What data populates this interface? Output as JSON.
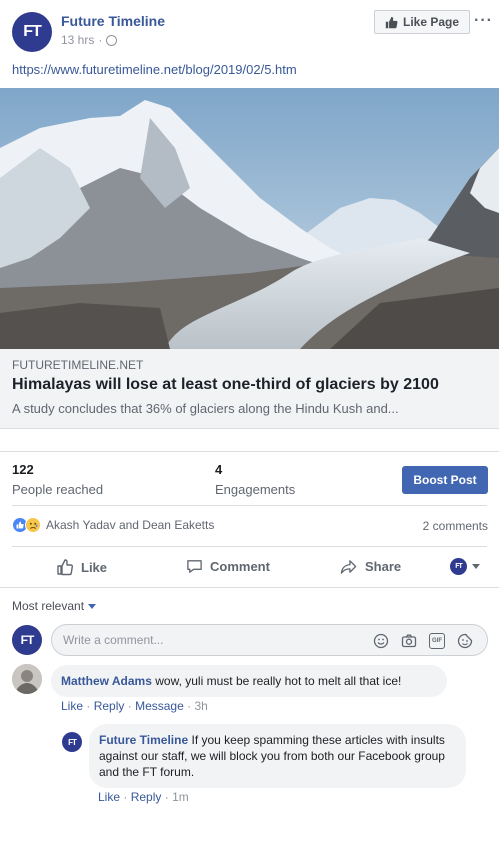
{
  "post": {
    "page_name": "Future Timeline",
    "logo_text": "FT",
    "time": "13 hrs",
    "separator": "·",
    "like_page_label": "Like Page",
    "more_label": "···",
    "link_url": "https://www.futuretimeline.net/blog/2019/02/5.htm"
  },
  "link_preview": {
    "domain": "FUTURETIMELINE.NET",
    "headline": "Himalayas will lose at least one-third of glaciers by 2100",
    "description": "A study concludes that 36% of glaciers along the Hindu Kush and..."
  },
  "stats": {
    "reached_value": "122",
    "reached_label": "People reached",
    "engagements_value": "4",
    "engagements_label": "Engagements",
    "boost_label": "Boost Post"
  },
  "reactions": {
    "names": "Akash Yadav and Dean Eaketts",
    "comments_count": "2 comments"
  },
  "actions": {
    "like": "Like",
    "comment": "Comment",
    "share": "Share"
  },
  "comments_section": {
    "sort_label": "Most relevant",
    "input_placeholder": "Write a comment...",
    "gif_label": "GIF"
  },
  "comments": [
    {
      "author": "Matthew Adams",
      "text": "wow, yuli must be really hot to melt all that ice!",
      "like": "Like",
      "reply": "Reply",
      "message": "Message",
      "time": "3h",
      "dot": "·"
    },
    {
      "author": "Future Timeline",
      "text": "If you keep spamming these articles with insults against our staff, we will block you from both our Facebook group and the FT forum.",
      "like": "Like",
      "reply": "Reply",
      "time": "1m",
      "dot": "·"
    }
  ],
  "colors": {
    "brand_link": "#385898",
    "boost_button": "#4267b2",
    "logo_bg": "#2e3b8f"
  }
}
